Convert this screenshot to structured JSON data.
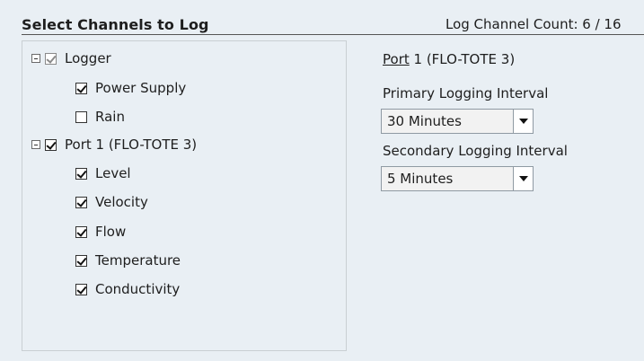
{
  "header": {
    "title": "Select Channels to Log",
    "count_text": "Log Channel Count: 6  /  16"
  },
  "tree": {
    "groups": [
      {
        "label": "Logger",
        "checked": true,
        "disabled": true,
        "children": [
          {
            "label": "Power Supply",
            "checked": true
          },
          {
            "label": "Rain",
            "checked": false
          }
        ]
      },
      {
        "label": "Port 1 (FLO-TOTE 3)",
        "checked": true,
        "disabled": false,
        "children": [
          {
            "label": "Level",
            "checked": true
          },
          {
            "label": "Velocity",
            "checked": true
          },
          {
            "label": "Flow",
            "checked": true
          },
          {
            "label": "Temperature",
            "checked": true
          },
          {
            "label": "Conductivity",
            "checked": true
          }
        ]
      }
    ]
  },
  "details": {
    "port_prefix": "Port",
    "port_suffix": " 1 (FLO-TOTE 3)",
    "primary_label": "Primary Logging Interval",
    "primary_value": "30 Minutes",
    "secondary_label": "Secondary Logging Interval",
    "secondary_value": "5 Minutes"
  }
}
